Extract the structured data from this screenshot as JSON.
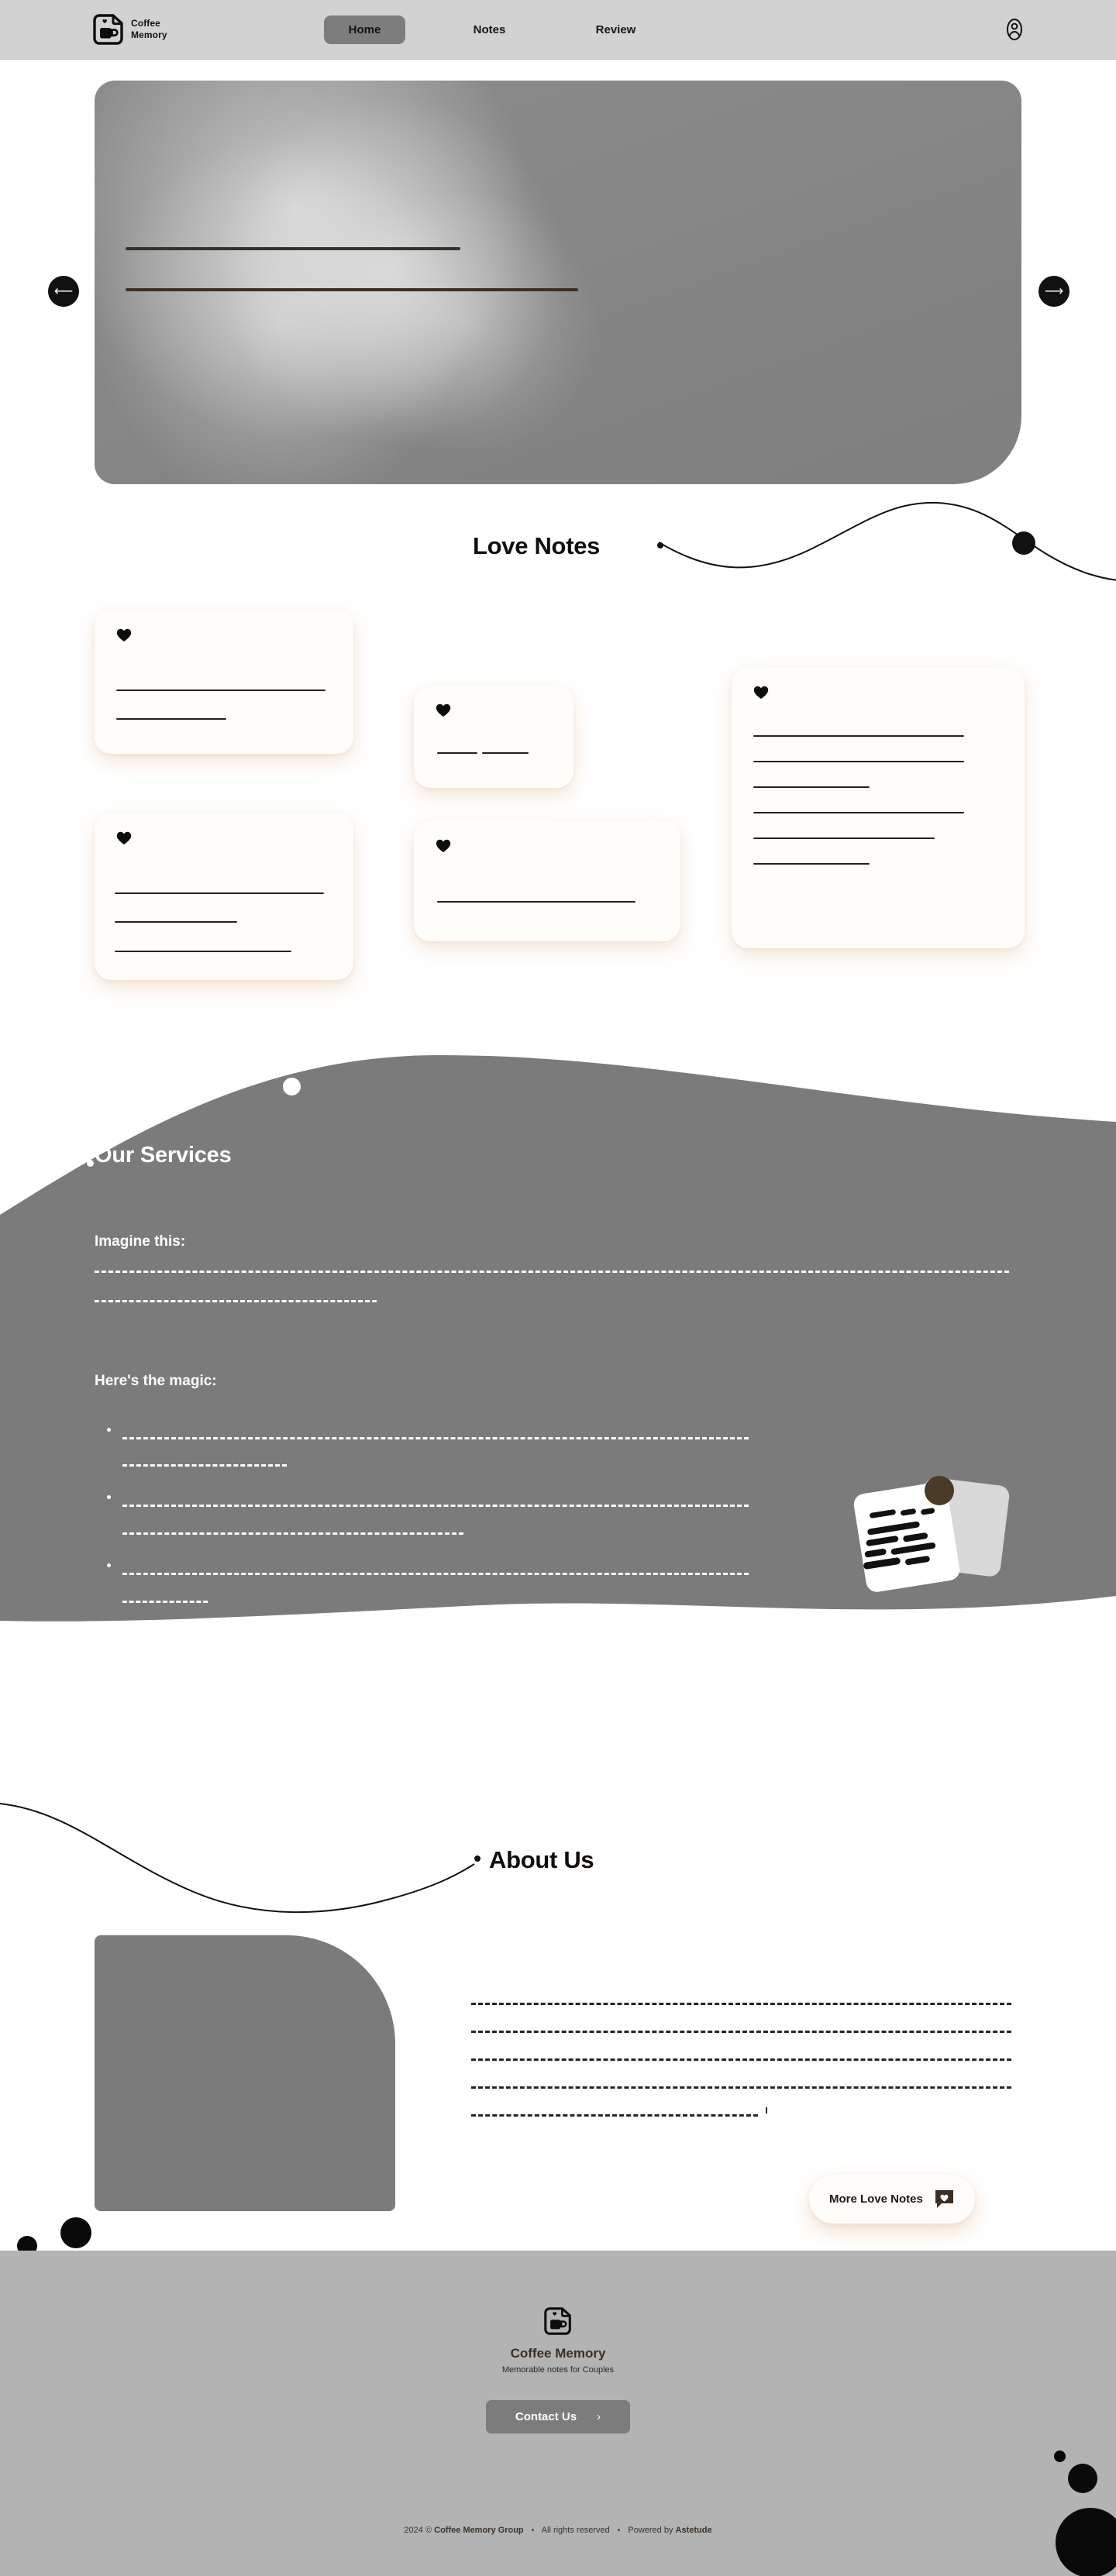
{
  "header": {
    "brand_line1": "Coffee",
    "brand_line2": "Memory",
    "logo_icon": "coffee-note-logo-icon",
    "nav": [
      {
        "label": "Home",
        "active": true
      },
      {
        "label": "Notes",
        "active": false
      },
      {
        "label": "Review",
        "active": false
      }
    ],
    "account_icon": "user-account-icon"
  },
  "hero": {
    "prev_icon": "arrow-left-icon",
    "next_icon": "arrow-right-icon",
    "placeholder_lines": 2
  },
  "love_notes": {
    "title": "Love Notes",
    "heart_icon": "heart-icon",
    "cards": [
      {
        "lines": [
          270,
          142
        ]
      },
      {
        "lines": [
          52,
          60
        ]
      },
      {
        "lines": [
          272,
          272,
          150,
          272,
          234,
          150
        ]
      },
      {
        "lines": [
          270,
          158,
          228
        ]
      },
      {
        "lines": [
          256
        ]
      }
    ]
  },
  "services": {
    "title": "Our Services",
    "imagine_heading": "Imagine this:",
    "magic_heading": "Here's the magic:",
    "bullets": 3,
    "illustration_icon": "sticky-notes-illustration-icon"
  },
  "about": {
    "title": "About Us",
    "paragraph_lines": 5,
    "more_button": {
      "label": "More Love Notes",
      "icon": "chat-heart-icon"
    }
  },
  "footer": {
    "logo_icon": "coffee-note-logo-icon",
    "name": "Coffee Memory",
    "tagline": "Memorable notes for Couples",
    "contact_label": "Contact Us",
    "contact_chevron": "›",
    "copyright_year": "2024 ©",
    "copyright_company": "Coffee Memory Group",
    "copyright_rights": "All rights reserved",
    "powered_prefix": "Powered by",
    "powered_by": "Astetude",
    "separator": "•"
  },
  "colors": {
    "header_bg": "#d2d2d2",
    "footer_bg": "#b3b3b3",
    "wave_gray": "#7b7b7b",
    "card_cream": "#fffdfa",
    "ink": "#1a1512",
    "brown": "#4a3a28"
  }
}
